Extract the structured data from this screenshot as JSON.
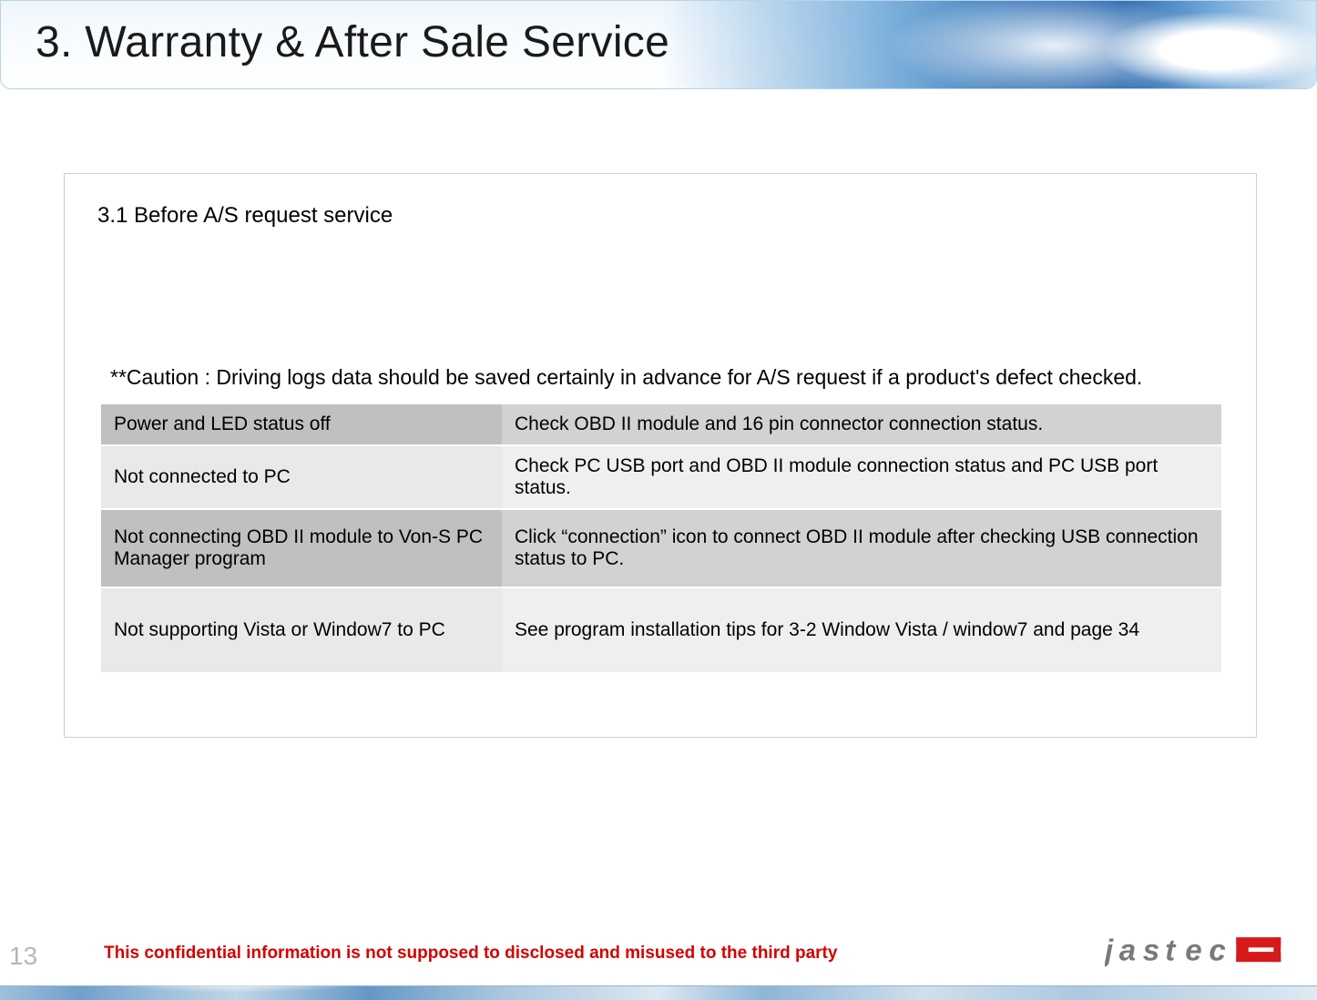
{
  "header": {
    "title": "3.  Warranty & After Sale Service"
  },
  "section": {
    "heading": "3.1 Before A/S request service",
    "caution": "**Caution : Driving logs data should be  saved certainly in advance for A/S request if a product's defect checked."
  },
  "table": {
    "rows": [
      {
        "left": "Power and LED status off",
        "right": "Check OBD II module and 16 pin connector connection status."
      },
      {
        "left": "Not connected to PC",
        "right": "Check PC USB port and OBD II module connection status and PC USB port status."
      },
      {
        "left": "Not connecting OBD II module to Von-S PC Manager program",
        "right": "Click “connection” icon to connect OBD II module after checking USB connection status to PC."
      },
      {
        "left": "Not supporting Vista or Window7 to PC",
        "right": "See program installation tips for 3-2 Window Vista / window7 and page 34"
      }
    ]
  },
  "footer": {
    "page": "13",
    "confidential": "This confidential information is not supposed to disclosed and misused to the third party",
    "logo_text": "jastec"
  }
}
